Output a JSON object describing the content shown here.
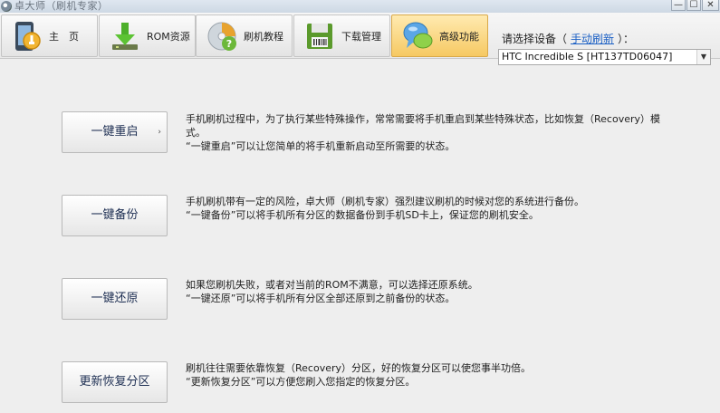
{
  "window": {
    "title": "卓大师（刷机专家）",
    "min_glyph": "—",
    "max_glyph": "☐",
    "close_glyph": "✕"
  },
  "toolbar": {
    "tabs": [
      {
        "label": "主　页",
        "icon": "home-phone-icon"
      },
      {
        "label": "ROM资源",
        "icon": "rom-download-icon"
      },
      {
        "label": "刷机教程",
        "icon": "help-cd-icon"
      },
      {
        "label": "下载管理",
        "icon": "download-manager-icon"
      },
      {
        "label": "高级功能",
        "icon": "advanced-chat-icon",
        "active": true
      }
    ],
    "device_prompt": "请选择设备（",
    "device_link": "手动刷新",
    "device_prompt_end": "）：",
    "device_selected": "HTC Incredible S [HT137TD06047]"
  },
  "main": {
    "actions": [
      {
        "label": "一键重启",
        "caret": "›",
        "lines": [
          "手机刷机过程中，为了执行某些特殊操作，常常需要将手机重启到某些特殊状态，比如恢复（Recovery）模式。",
          "“一键重启”可以让您简单的将手机重新启动至所需要的状态。"
        ]
      },
      {
        "label": "一键备份",
        "lines": [
          "手机刷机带有一定的风险，卓大师（刷机专家）强烈建议刷机的时候对您的系统进行备份。",
          "“一键备份”可以将手机所有分区的数据备份到手机SD卡上，保证您的刷机安全。"
        ]
      },
      {
        "label": "一键还原",
        "lines": [
          "如果您刷机失败，或者对当前的ROM不满意，可以选择还原系统。",
          "“一键还原”可以将手机所有分区全部还原到之前备份的状态。"
        ]
      },
      {
        "label": "更新恢复分区",
        "lines": [
          "刷机往往需要依靠恢复（Recovery）分区，好的恢复分区可以使您事半功倍。",
          "“更新恢复分区”可以方便您刷入您指定的恢复分区。"
        ]
      }
    ]
  }
}
